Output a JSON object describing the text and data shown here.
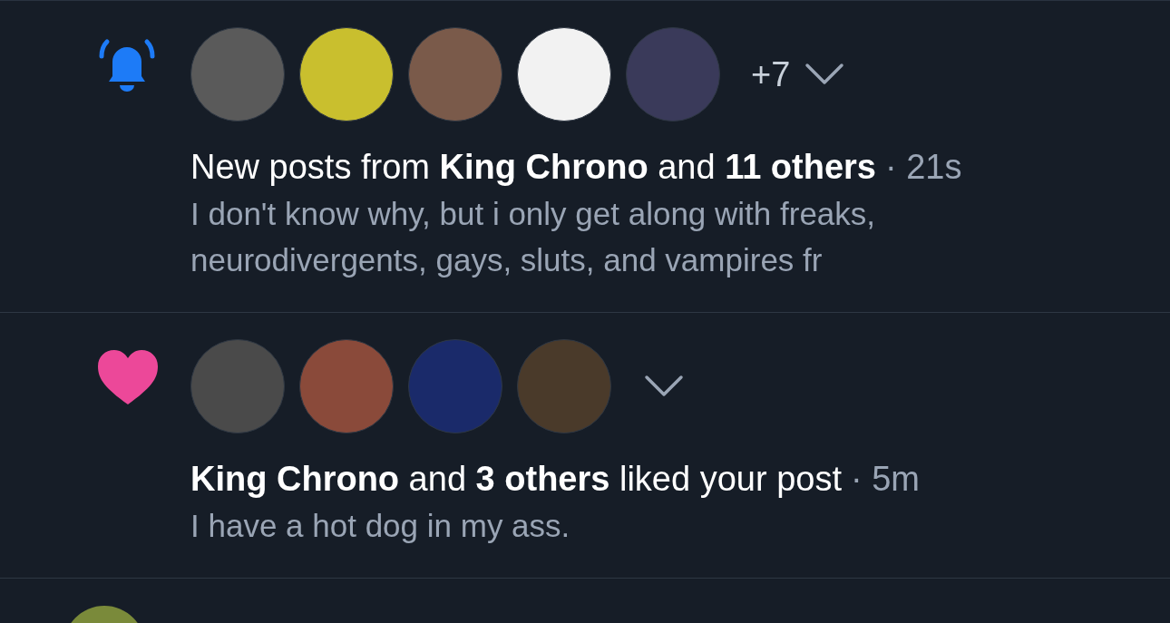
{
  "notifications": [
    {
      "kind": "posts",
      "avatars": [
        {
          "color": "#5a5a5a"
        },
        {
          "color": "#c9bf2e"
        },
        {
          "color": "#7a5a4a"
        },
        {
          "color": "#f2f2f2"
        },
        {
          "color": "#3a3a5a"
        }
      ],
      "overflow": "+7",
      "headline": "New posts from **King Chrono** and **11 others**",
      "time": "· 21s",
      "body": "I don't know why, but i only get along with freaks, neurodivergents, gays, sluts, and vampires fr"
    },
    {
      "kind": "like",
      "avatars": [
        {
          "color": "#4a4a4a"
        },
        {
          "color": "#8a4a3a"
        },
        {
          "color": "#1a2a6a"
        },
        {
          "color": "#4a3a2a"
        }
      ],
      "headline": "**King Chrono** and **3 others** liked your post",
      "time": "· 5m",
      "body": "I have a hot dog in my ass."
    }
  ],
  "next_post": {
    "avatar": {
      "color": "#7a8a3a"
    }
  }
}
